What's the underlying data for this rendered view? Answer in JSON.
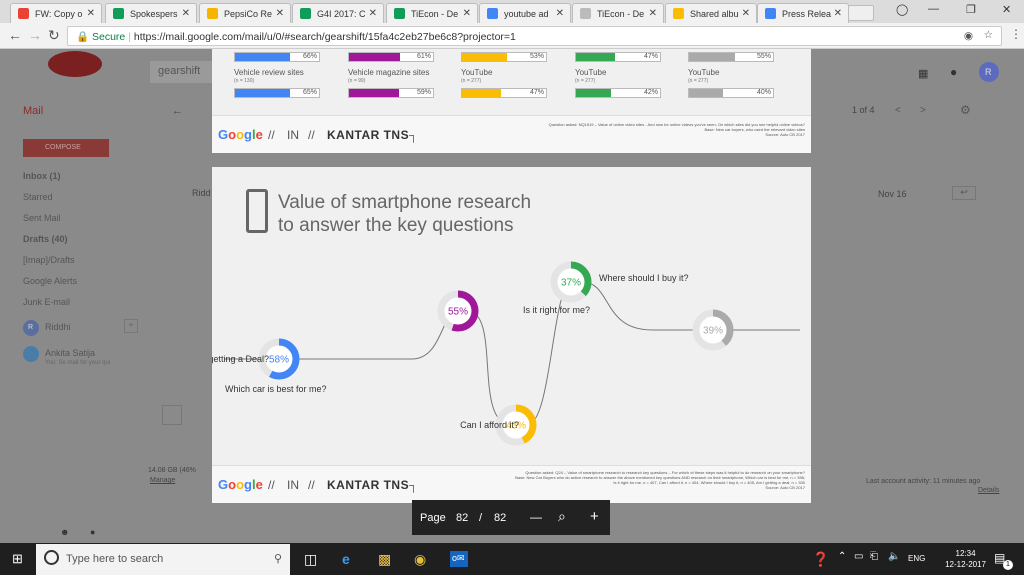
{
  "browser": {
    "tabs": [
      {
        "label": "FW: Copy o",
        "fav": "#ea4335",
        "fav_icon": "gmail-icon"
      },
      {
        "label": "Spokespers",
        "fav": "#0f9d58",
        "fav_icon": "sheets-icon"
      },
      {
        "label": "PepsiCo Re",
        "fav": "#f4b400",
        "fav_icon": "slides-icon"
      },
      {
        "label": "G4I 2017: C",
        "fav": "#0f9d58",
        "fav_icon": "sheets-icon"
      },
      {
        "label": "TiEcon - De",
        "fav": "#0f9d58",
        "fav_icon": "sheets-icon"
      },
      {
        "label": "youtube ad",
        "fav": "#4285f4",
        "fav_icon": "google-icon"
      },
      {
        "label": "TiEcon - De",
        "fav": "#bbbbbb",
        "fav_icon": "page-icon"
      },
      {
        "label": "Shared albu",
        "fav": "#fbbc05",
        "fav_icon": "photos-icon"
      },
      {
        "label": "Press Relea",
        "fav": "#4285f4",
        "fav_icon": "docs-icon"
      }
    ],
    "secure_label": "Secure",
    "url": "https://mail.google.com/mail/u/0/#search/gearshift/15fa4c2eb27be6c8?projector=1"
  },
  "gmail": {
    "search_text": "gearshift",
    "mail_label": "Mail",
    "compose_label": "COMPOSE",
    "pagination": "1 of 4",
    "date": "Nov 16",
    "sender_fragment": "Ridd",
    "sidebar": [
      "Inbox (1)",
      "Starred",
      "Sent Mail",
      "Drafts (40)",
      "[Imap]/Drafts",
      "Google Alerts",
      "Junk E-mail"
    ],
    "chat_user": "Riddhi",
    "chat_user2": "Ankita Satija",
    "chat_user2_status": "You: Se mail for your qui",
    "storage": "14.08 GB (46%",
    "manage": "Manage",
    "activity": "Last account activity: 11 minutes ago",
    "details": "Details"
  },
  "slide1": {
    "bars_top": [
      {
        "pct": "66%",
        "fill": 0.66,
        "color": "#4285f4"
      },
      {
        "pct": "61%",
        "fill": 0.61,
        "color": "#a0179a"
      },
      {
        "pct": "53%",
        "fill": 0.53,
        "color": "#fbbc05"
      },
      {
        "pct": "47%",
        "fill": 0.47,
        "color": "#34a853"
      },
      {
        "pct": "55%",
        "fill": 0.55,
        "color": "#aaaaaa"
      }
    ],
    "labels": [
      {
        "name": "Vehicle review sites",
        "n": "(n = 130)"
      },
      {
        "name": "Vehicle magazine sites",
        "n": "(n = 99)"
      },
      {
        "name": "YouTube",
        "n": "(n = 277)"
      },
      {
        "name": "YouTube",
        "n": "(n = 277)"
      },
      {
        "name": "YouTube",
        "n": "(n = 277)"
      }
    ],
    "bars_bottom": [
      {
        "pct": "65%",
        "fill": 0.65,
        "color": "#4285f4"
      },
      {
        "pct": "59%",
        "fill": 0.59,
        "color": "#a0179a"
      },
      {
        "pct": "47%",
        "fill": 0.47,
        "color": "#fbbc05"
      },
      {
        "pct": "42%",
        "fill": 0.42,
        "color": "#34a853"
      },
      {
        "pct": "40%",
        "fill": 0.4,
        "color": "#aaaaaa"
      }
    ],
    "footnote": "Question asked: NQ1519 – Value of online video sites - And now for online videos you've seen; On which sites did you see helpful online videos?\nBase: New car buyers, who used the relevant video sites\nSource: Auto CB 2017"
  },
  "slide2": {
    "title_line1": "Value of smartphone research",
    "title_line2": "to answer the key questions",
    "steps": [
      {
        "pct": "58%",
        "value": 0.58,
        "color": "#4285f4",
        "label": "Which car is best for me?"
      },
      {
        "pct": "55%",
        "value": 0.55,
        "color": "#a0179a",
        "label": "Is it right for me?"
      },
      {
        "pct": "43%",
        "value": 0.43,
        "color": "#fbbc05",
        "label": "Can I afford it?"
      },
      {
        "pct": "37%",
        "value": 0.37,
        "color": "#34a853",
        "label": "Where should I buy it?"
      },
      {
        "pct": "39%",
        "value": 0.39,
        "color": "#aaaaaa",
        "label": "Am I getting a Deal?"
      }
    ],
    "footnote": "Question asked: Q24 – Value of smartphone research to research key questions – For which of these steps was it helpful to do research on your smartphone?\nBase: New Car Buyers who do active research to answer the above mentioned key questions AND research on their smartphone, Which car is best for me, n = 398;\nIs it right for me, n = 407, Can I afford it, n = 404, Where should I buy it, n = 405, Am I getting a deal, n = 330\nSource: Auto CB 2017"
  },
  "logo": {
    "google": [
      "G",
      "o",
      "o",
      "g",
      "l",
      "e"
    ],
    "sep": "//",
    "in": "IN",
    "kantar": "KANTAR TNS",
    "kantar_mark": "┐"
  },
  "viewer": {
    "page_label": "Page",
    "page": "82",
    "sep": "/",
    "total": "82",
    "minus": "—",
    "zoom": "⌕",
    "plus": "+"
  },
  "taskbar": {
    "search_placeholder": "Type here to search",
    "lang": "ENG",
    "time": "12:34",
    "date": "12-12-2017",
    "notif": "1"
  }
}
